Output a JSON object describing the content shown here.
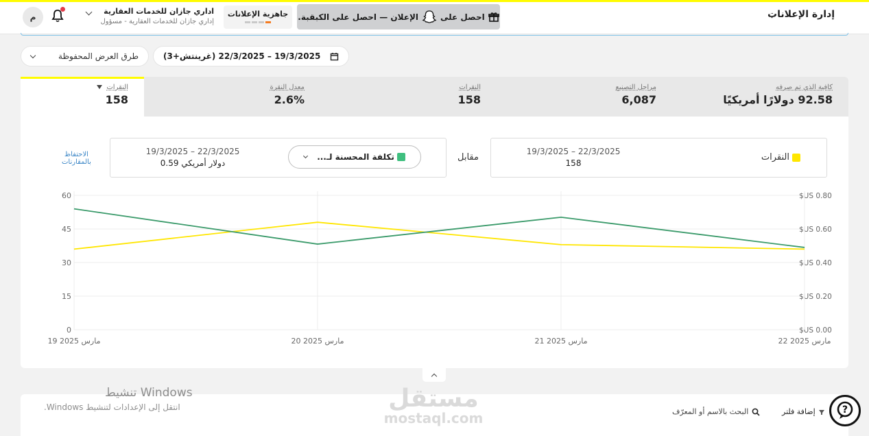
{
  "header": {
    "section_title": "إدارة الإعلانات",
    "promo_text": "احصل على 🎁 الإعلان — احصل على الكبقبة.",
    "promo_prefix": "احصل على",
    "promo_middle": "الإعلان — احصل على الكبقبة.",
    "ads_readiness": "جاهزية الإعلانات",
    "account_name": "اداري جازان للخدمات العقارية",
    "account_sub": "إداري جازان للخدمات العقارية - مسؤول",
    "avatar_letter": "م"
  },
  "filters": {
    "saved_views": "طرق العرض المحفوظة",
    "date_range": "19/3/2025 – 22/3/2025 (غرينتش+3)"
  },
  "kpis": [
    {
      "label": "كافية الذي تم صرفه",
      "value": "92.58 دولارًا أمريكيًا"
    },
    {
      "label": "مراجل التصنيع",
      "value": "6,087"
    },
    {
      "label": "النقرات",
      "value": "158"
    },
    {
      "label": "معدل النقرة",
      "value": "2.6%"
    },
    {
      "label": "النقرات",
      "value": "158"
    }
  ],
  "comparison": {
    "primary_metric": "النقرات",
    "primary_dates": "19/3/2025 – 22/3/2025",
    "primary_value": "158",
    "vs_label": "مقابل",
    "secondary_metric": "تكلفة المحسنة لـ...",
    "secondary_dates": "19/3/2025 – 22/3/2025",
    "secondary_value": "0.59 دولار أمريكي",
    "save_label_1": "الاحتفاظ",
    "save_label_2": "بالمقارنات"
  },
  "colors": {
    "clicks_line": "#ffe600",
    "cost_line": "#3a9a6a",
    "snap_yellow": "#fffc00",
    "promo_bg": "#cfd0d2"
  },
  "chart_data": {
    "type": "line",
    "categories": [
      "19 مارس 2025",
      "20 مارس 2025",
      "21 مارس 2025",
      "22 مارس 2025"
    ],
    "series": [
      {
        "name": "النقرات",
        "axis": "left",
        "values": [
          36,
          48,
          38,
          36
        ]
      },
      {
        "name": "تكلفة المحسنة لـ...",
        "axis": "right",
        "values": [
          0.72,
          0.51,
          0.67,
          0.49
        ]
      }
    ],
    "y_left_ticks": [
      "60",
      "45",
      "30",
      "15",
      "0"
    ],
    "y_left_range": [
      0,
      60
    ],
    "y_right_ticks": [
      "$US 0.80",
      "$US 0.60",
      "$US 0.40",
      "$US 0.20",
      "$US 0.00"
    ],
    "y_right_range": [
      0,
      0.8
    ],
    "grid": true
  },
  "bottom": {
    "add_filter": "إضافة فلتر",
    "search_placeholder": "البحث بالاسم أو المعرّف",
    "windows_title": "تنشيط Windows",
    "windows_sub": "انتقل إلى الإعدادات لتنشيط Windows."
  }
}
